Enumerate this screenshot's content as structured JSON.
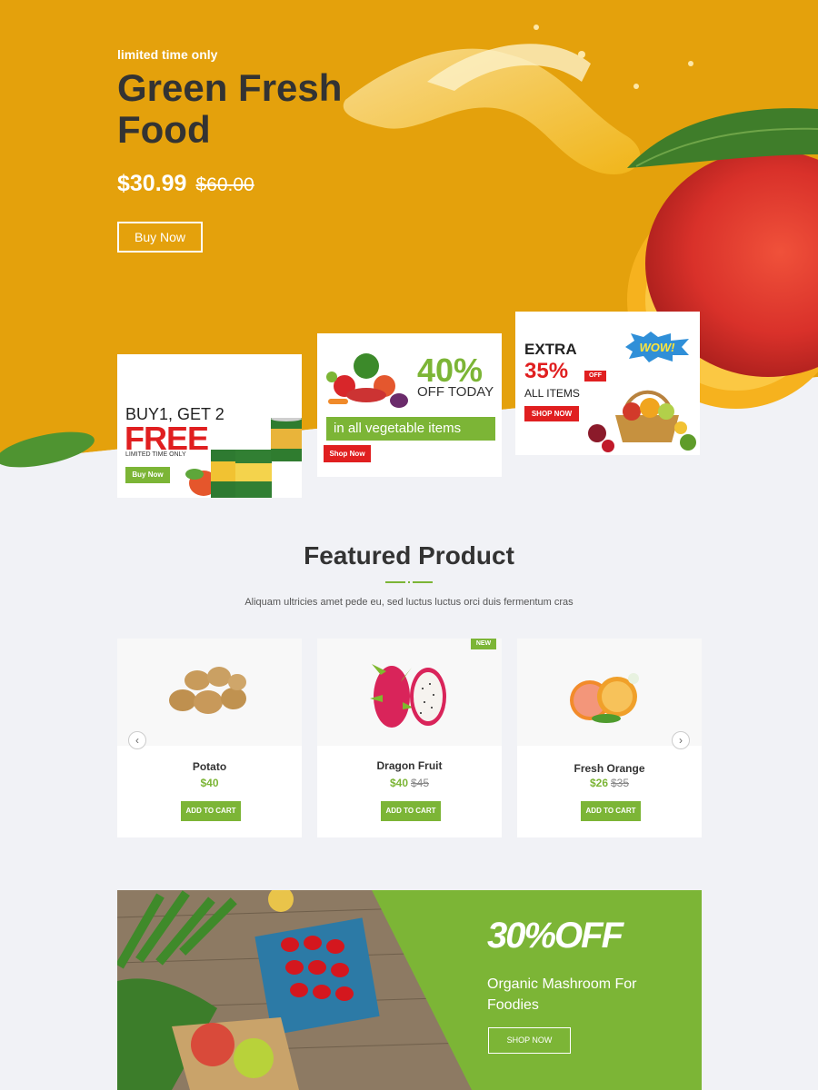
{
  "hero": {
    "kicker": "limited time only",
    "title": "Green Fresh Food",
    "price": "$30.99",
    "old_price": "$60.00",
    "button": "Buy Now"
  },
  "promos": {
    "p1": {
      "line1": "BUY1, GET 2",
      "line2": "FREE",
      "line3": "LIMITED TIME ONLY",
      "button": "Buy Now"
    },
    "p2": {
      "percent": "40%",
      "off": "OFF TODAY",
      "bar": "in all vegetable items",
      "button": "Shop Now"
    },
    "p3": {
      "line1": "EXTRA",
      "line2": "35%",
      "off": "OFF",
      "line3": "ALL ITEMS",
      "button": "SHOP NOW",
      "burst": "WOW!"
    }
  },
  "featured": {
    "title": "Featured Product",
    "subtitle": "Aliquam ultricies amet pede eu, sed luctus luctus orci duis fermentum cras",
    "cart_label": "ADD TO CART",
    "badge": "NEW",
    "prev_icon": "chevron-left-icon",
    "next_icon": "chevron-right-icon",
    "products": [
      {
        "name": "Potato",
        "price": "$40",
        "old_price": ""
      },
      {
        "name": "Dragon Fruit",
        "price": "$40",
        "old_price": "$45"
      },
      {
        "name": "Fresh Orange",
        "price": "$26",
        "old_price": "$35"
      }
    ]
  },
  "bottom_banner": {
    "headline": "30%OFF",
    "text": "Organic Mashroom For Foodies",
    "button": "SHOP NOW"
  },
  "colors": {
    "hero_yellow": "#e4a10c",
    "accent_green": "#7cb536",
    "promo_red": "#e01f20",
    "text_dark": "#333333"
  }
}
